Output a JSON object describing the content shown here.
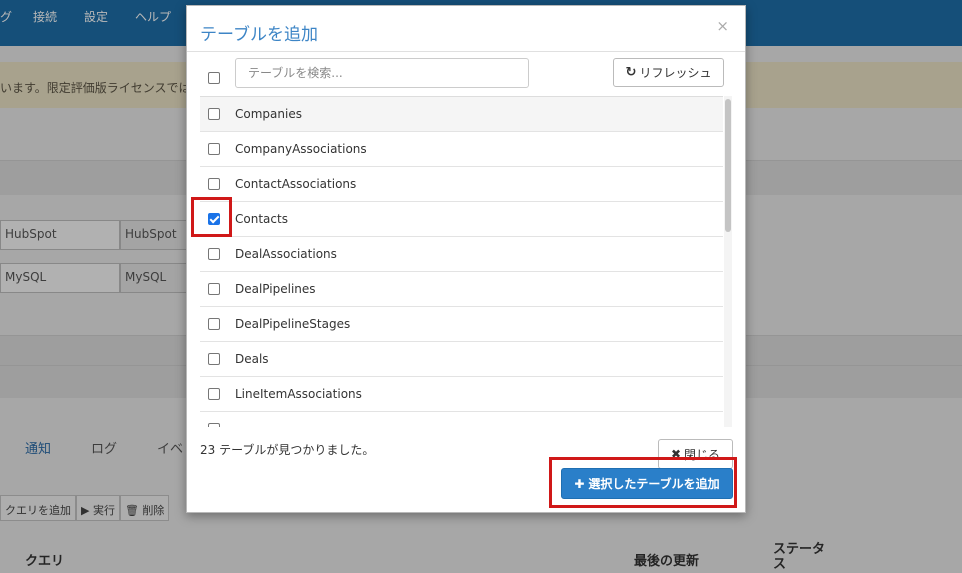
{
  "background": {
    "nav": [
      "グ",
      "接続",
      "設定",
      "ヘルプ"
    ],
    "banner_text": "います。限定評価版ライセンスでは",
    "source_input": "HubSpot",
    "source_type": "HubSpot",
    "dest_input": "MySQL",
    "dest_type": "MySQL",
    "tabs": [
      "通知",
      "ログ",
      "イベ"
    ],
    "toolbar": [
      "クエリを追加",
      "▶ 実行",
      "🗑 削除"
    ],
    "headers": {
      "query": "クエリ",
      "last_updated": "最後の更新",
      "status": "ステータス"
    }
  },
  "modal": {
    "title": "テーブルを追加",
    "close_symbol": "×",
    "search_placeholder": "テーブルを検索...",
    "refresh_label": "リフレッシュ",
    "tables": [
      {
        "name": "Companies",
        "checked": false
      },
      {
        "name": "CompanyAssociations",
        "checked": false
      },
      {
        "name": "ContactAssociations",
        "checked": false
      },
      {
        "name": "Contacts",
        "checked": true
      },
      {
        "name": "DealAssociations",
        "checked": false
      },
      {
        "name": "DealPipelines",
        "checked": false
      },
      {
        "name": "DealPipelineStages",
        "checked": false
      },
      {
        "name": "Deals",
        "checked": false
      },
      {
        "name": "LineItemAssociations",
        "checked": false
      }
    ],
    "found_text": "23 テーブルが見つかりました。",
    "close_label": "閉じる",
    "add_label": "選択したテーブルを追加"
  },
  "colors": {
    "accent": "#2a7fc9",
    "highlight": "#d01818",
    "nav": "#1e6ea8"
  }
}
